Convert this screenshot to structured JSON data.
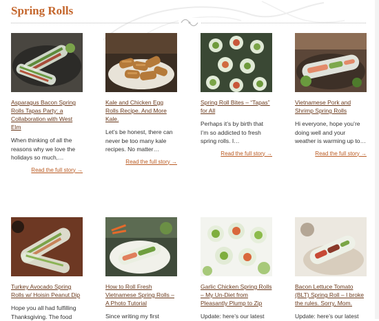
{
  "section": {
    "title": "Spring Rolls"
  },
  "read_more": "Read the full story →",
  "posts": [
    {
      "title": "Asparagus Bacon Spring Rolls Tapas Party: a Collaboration with West Elm",
      "excerpt": "When thinking of all the reasons why we love the holidays so much,…",
      "image": "asparagus-bacon-spring-rolls-photo"
    },
    {
      "title": "Kale and Chicken Egg Rolls Recipe. And More Kale.",
      "excerpt": "Let’s be honest, there can never be too many kale recipes. No matter…",
      "image": "kale-chicken-egg-rolls-photo"
    },
    {
      "title": "Spring Roll Bites – “Tapas” for All",
      "excerpt": "Perhaps it’s by birth that I’m so addicted to fresh spring rolls. I…",
      "image": "spring-roll-bites-photo"
    },
    {
      "title": "Vietnamese Pork and Shrimp Spring Rolls",
      "excerpt": "Hi everyone,  hope you’re doing well and your weather is warming up to…",
      "image": "pork-shrimp-spring-rolls-photo"
    },
    {
      "title": "Turkey Avocado Spring Rolls w/ Hoisin Peanut Dip",
      "excerpt": "Hope you all had fulfilling Thanksgiving. The food",
      "image": "turkey-avocado-spring-rolls-photo"
    },
    {
      "title": "How to Roll Fresh Vietnamese Spring Rolls – A Photo Tutorial",
      "excerpt": "Since writing my first",
      "image": "fresh-vietnamese-spring-rolls-photo"
    },
    {
      "title": "Garlic Chicken Spring Rolls – My Un-Diet from Pleasantly Plump to Zip",
      "excerpt": "Update: here’s our latest",
      "image": "garlic-chicken-spring-rolls-photo"
    },
    {
      "title": "Bacon Lettuce Tomato (BLT) Spring Roll – I broke the rules. Sorry, Mom.",
      "excerpt": "Update: here’s our latest",
      "image": "blt-spring-roll-photo"
    }
  ]
}
